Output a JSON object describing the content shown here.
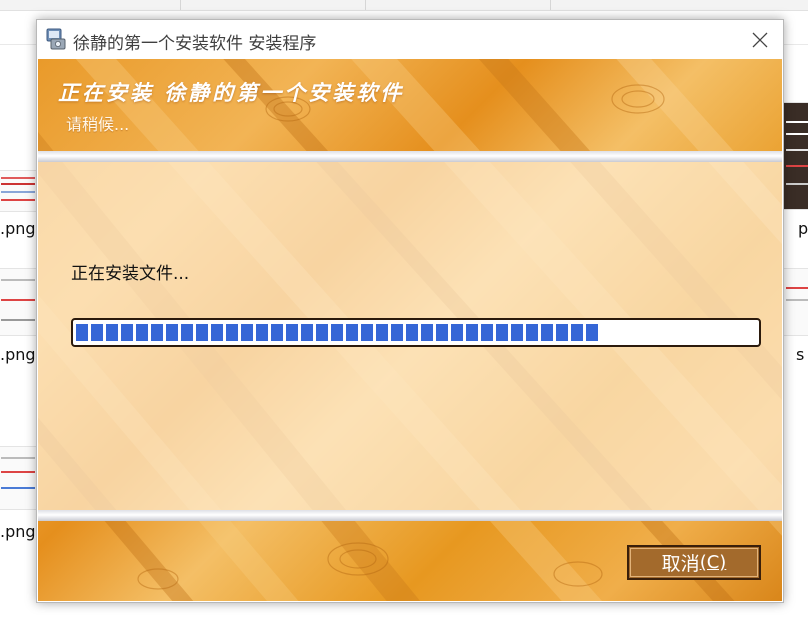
{
  "window": {
    "title": "徐静的第一个安装软件 安装程序",
    "close_symbol": "✕"
  },
  "header": {
    "title": "正在安装 徐静的第一个安装软件",
    "subtitle": "请稍候..."
  },
  "body": {
    "status_text": "正在安装文件..."
  },
  "progress": {
    "fraction": 0.77
  },
  "buttons": {
    "cancel_label": "取消",
    "cancel_shortcut": "(C)"
  },
  "background": {
    "file_labels": [
      ".png",
      ".png",
      ".png",
      "p",
      "s"
    ]
  },
  "colors": {
    "accent_progress": "#3566d6",
    "button_bg": "#a36a2c"
  }
}
